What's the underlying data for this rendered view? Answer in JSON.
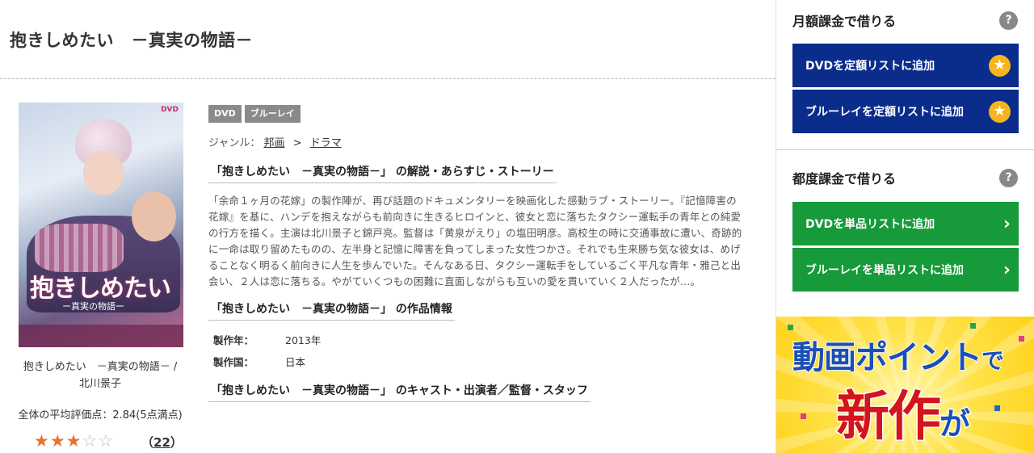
{
  "title": "抱きしめたい　－真実の物語－",
  "poster": {
    "title_art": "抱きしめたい",
    "subtitle_art": "ー真実の物語ー",
    "format_mark": "DVD"
  },
  "caption": {
    "line1": "抱きしめたい　－真実の物語－ /",
    "line2": "北川景子"
  },
  "rating": {
    "average_text": "全体の平均評価点：2.84(5点満点)",
    "stars_filled": 3,
    "stars_total": 5,
    "count_prefix": "（",
    "count": "22",
    "count_suffix": "）"
  },
  "badges": [
    "DVD",
    "ブルーレイ"
  ],
  "genre": {
    "label": "ジャンル：",
    "items": [
      "邦画",
      "ドラマ"
    ],
    "separator": ">"
  },
  "sections": {
    "story_head": "「抱きしめたい　－真実の物語－」 の解説・あらすじ・ストーリー",
    "story_text": "「余命１ヶ月の花嫁」の製作陣が、再び話題のドキュメンタリーを映画化した感動ラブ・ストーリー。『記憶障害の花嫁』を基に、ハンデを抱えながらも前向きに生きるヒロインと、彼女と恋に落ちたタクシー運転手の青年との純愛の行方を描く。主演は北川景子と錦戸亮。監督は「黄泉がえり」の塩田明彦。高校生の時に交通事故に遭い、奇跡的に一命は取り留めたものの、左半身と記憶に障害を負ってしまった女性つかさ。それでも生来勝ち気な彼女は、めげることなく明るく前向きに人生を歩んでいた。そんなある日、タクシー運転手をしているごく平凡な青年・雅己と出会い、２人は恋に落ちる。やがていくつもの困難に直面しながらも互いの愛を貫いていく２人だったが…。",
    "info_head": "「抱きしめたい　－真実の物語－」 の作品情報",
    "info": [
      {
        "key": "製作年：",
        "value": "2013年"
      },
      {
        "key": "製作国：",
        "value": "日本"
      }
    ],
    "cast_head": "「抱きしめたい　－真実の物語－」 のキャスト・出演者／監督・スタッフ"
  },
  "sidebar": {
    "monthly": {
      "heading": "月額課金で借りる",
      "help": "?",
      "buttons": [
        {
          "label": "DVDを定額リストに追加",
          "icon": "star-icon"
        },
        {
          "label": "ブルーレイを定額リストに追加",
          "icon": "star-icon"
        }
      ]
    },
    "per_item": {
      "heading": "都度課金で借りる",
      "help": "?",
      "buttons": [
        {
          "label": "DVDを単品リストに追加",
          "icon": "chevron-right-icon"
        },
        {
          "label": "ブルーレイを単品リストに追加",
          "icon": "chevron-right-icon"
        }
      ]
    },
    "banner": {
      "line1": "動画ポイント",
      "line1_tail": "で",
      "line2": "新作",
      "line2_tail": "が"
    }
  },
  "colors": {
    "blue_button": "#0a2d8c",
    "green_button": "#169a3a",
    "star_orange": "#e8732b",
    "badge_gray": "#8a8a8a"
  }
}
